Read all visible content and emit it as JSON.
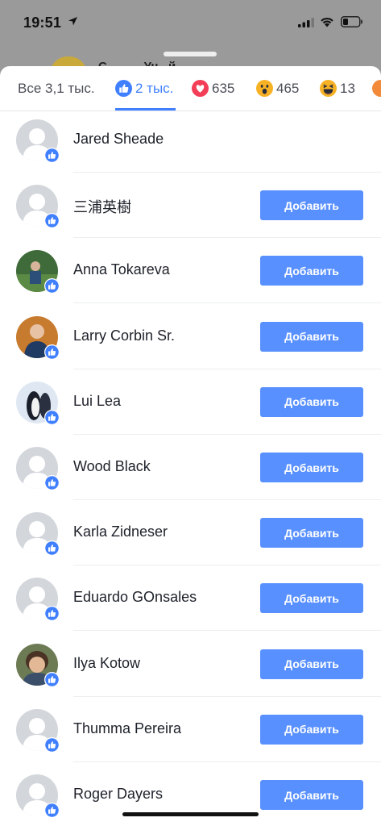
{
  "status_bar": {
    "time": "19:51"
  },
  "behind_text": "С...........Ун...й",
  "tabs": {
    "all": "Все 3,1 тыс.",
    "like": "2 тыс.",
    "love": "635",
    "wow": "465",
    "haha": "13"
  },
  "people": [
    {
      "name": "Jared Sheade",
      "button": ""
    },
    {
      "name": "三浦英樹",
      "button": "Добавить"
    },
    {
      "name": "Anna Tokareva",
      "button": "Добавить"
    },
    {
      "name": "Larry Corbin Sr.",
      "button": "Добавить"
    },
    {
      "name": "Lui Lea",
      "button": "Добавить"
    },
    {
      "name": "Wood Black",
      "button": "Добавить"
    },
    {
      "name": "Karla Zidneser",
      "button": "Добавить"
    },
    {
      "name": "Eduardo GOnsales",
      "button": "Добавить"
    },
    {
      "name": "Ilya Kotow",
      "button": "Добавить"
    },
    {
      "name": "Thumma Pereira",
      "button": "Добавить"
    },
    {
      "name": "Roger Dayers",
      "button": "Добавить"
    }
  ],
  "colors": {
    "accent": "#4080ff",
    "button": "#5890ff",
    "love": "#f33e58",
    "wow": "#f7b125"
  }
}
